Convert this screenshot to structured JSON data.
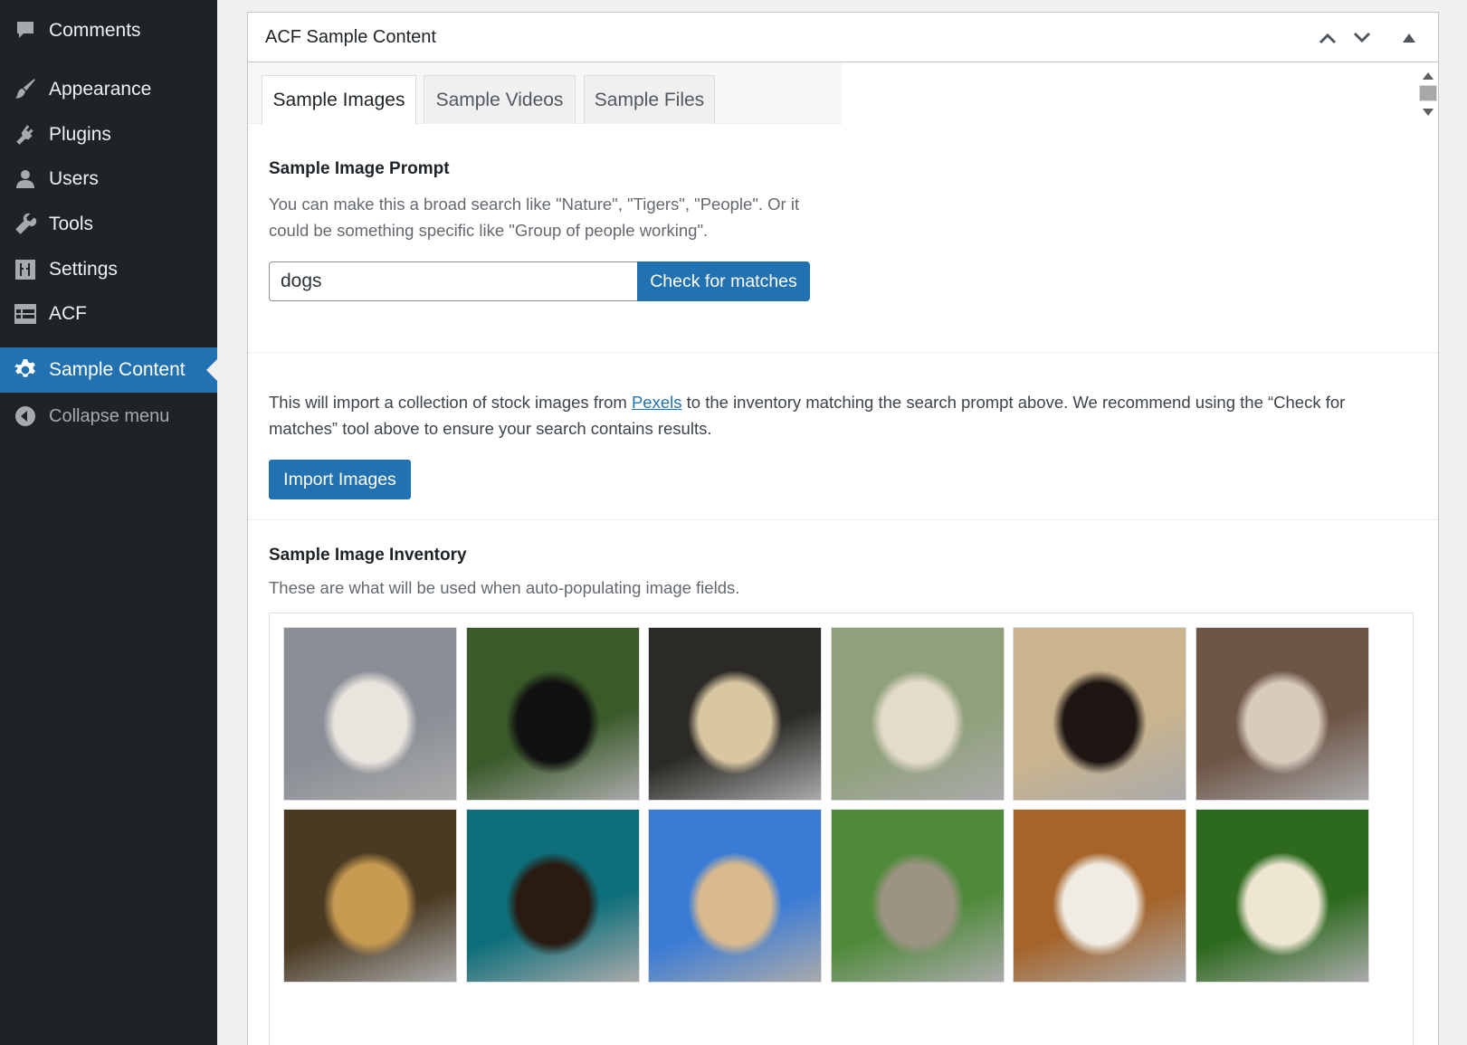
{
  "sidebar": {
    "items": [
      {
        "label": "Comments",
        "icon": "comments-icon"
      },
      {
        "label": "Appearance",
        "icon": "appearance-brush-icon"
      },
      {
        "label": "Plugins",
        "icon": "plugins-icon"
      },
      {
        "label": "Users",
        "icon": "users-icon"
      },
      {
        "label": "Tools",
        "icon": "tools-wrench-icon"
      },
      {
        "label": "Settings",
        "icon": "settings-sliders-icon"
      },
      {
        "label": "ACF",
        "icon": "acf-table-icon"
      },
      {
        "label": "Sample Content",
        "icon": "gear-icon",
        "active": true
      },
      {
        "label": "Collapse menu",
        "icon": "collapse-arrow-icon"
      }
    ]
  },
  "postbox": {
    "title": "ACF Sample Content",
    "tabs": [
      {
        "label": "Sample Images",
        "active": true
      },
      {
        "label": "Sample Videos"
      },
      {
        "label": "Sample Files"
      }
    ]
  },
  "prompt": {
    "label": "Sample Image Prompt",
    "description": "You can make this a broad search like \"Nature\", \"Tigers\", \"People\". Or it could be something specific like \"Group of people working\".",
    "input_value": "dogs",
    "check_button": "Check for matches"
  },
  "import": {
    "text_before": "This will import a collection of stock images from ",
    "link_text": "Pexels",
    "text_after": " to the inventory matching the search prompt above. We recommend using the “Check for matches” tool above to ensure your search contains results.",
    "button": "Import Images"
  },
  "inventory": {
    "label": "Sample Image Inventory",
    "description": "These are what will be used when auto-populating image fields.",
    "images": [
      {
        "name": "white poodle on chair",
        "colors": [
          "#8a8f96",
          "#e9e4dd"
        ]
      },
      {
        "name": "black dog licking",
        "colors": [
          "#3a5a2a",
          "#111111"
        ]
      },
      {
        "name": "two labradors lying",
        "colors": [
          "#2c2a26",
          "#d8c7a1"
        ]
      },
      {
        "name": "two labradors sitting in field",
        "colors": [
          "#8fa07a",
          "#e4dccb"
        ]
      },
      {
        "name": "rottweiler lying",
        "colors": [
          "#c9b48e",
          "#1e1612"
        ]
      },
      {
        "name": "dog with glasses",
        "colors": [
          "#6e5647",
          "#d7cbbd"
        ]
      },
      {
        "name": "puppies in basket",
        "colors": [
          "#4a3a22",
          "#c79a52"
        ]
      },
      {
        "name": "dachshund on teal",
        "colors": [
          "#0e6f7a",
          "#2a1b12"
        ]
      },
      {
        "name": "corgi on beach",
        "colors": [
          "#3a7bd5",
          "#d9b98e"
        ]
      },
      {
        "name": "dogs on swings in park",
        "colors": [
          "#4f8a3a",
          "#9c9383"
        ]
      },
      {
        "name": "beagle and westie",
        "colors": [
          "#a5642a",
          "#f0ece3"
        ]
      },
      {
        "name": "golden retriever in grass",
        "colors": [
          "#2d6a1e",
          "#efe6d2"
        ]
      }
    ]
  },
  "colors": {
    "sidebar_bg": "#1d2327",
    "accent": "#2271b1"
  }
}
